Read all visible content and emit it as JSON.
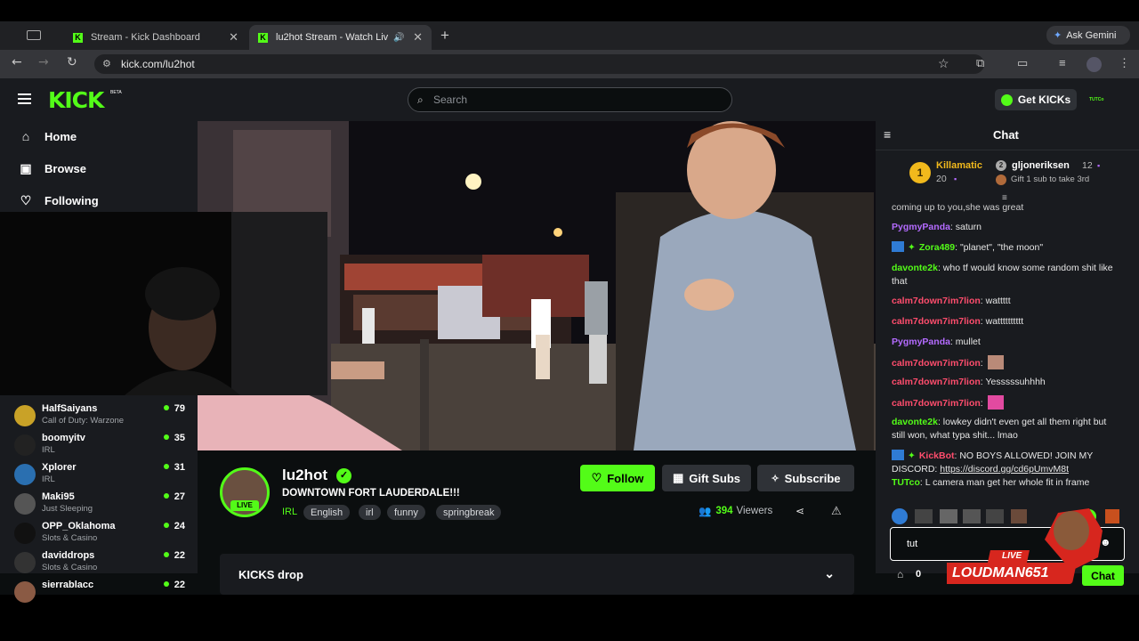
{
  "browser": {
    "tabs": [
      {
        "title": "Stream - Kick Dashboard"
      },
      {
        "title": "lu2hot Stream - Watch Liv"
      }
    ],
    "new_tab": "+",
    "ask_gemini": "Ask Gemini",
    "url": "kick.com/lu2hot"
  },
  "site": {
    "logo": "KICK",
    "beta": "BETA",
    "search_placeholder": "Search",
    "get_kicks": "Get KICKs",
    "user_tag": "TUTCo"
  },
  "sidebar": {
    "nav": [
      {
        "label": "Home",
        "icon": "home-icon"
      },
      {
        "label": "Browse",
        "icon": "browse-icon"
      },
      {
        "label": "Following",
        "icon": "heart-icon"
      }
    ],
    "channels": [
      {
        "name": "HalfSaiyans",
        "category": "Call of Duty: Warzone",
        "viewers": "79",
        "color": "#c9a227"
      },
      {
        "name": "boomyitv",
        "category": "IRL",
        "viewers": "35",
        "color": "#222222"
      },
      {
        "name": "Xplorer",
        "category": "IRL",
        "viewers": "31",
        "color": "#2a6fb0"
      },
      {
        "name": "Maki95",
        "category": "Just Sleeping",
        "viewers": "27",
        "color": "#555555"
      },
      {
        "name": "OPP_Oklahoma",
        "category": "Slots & Casino",
        "viewers": "24",
        "color": "#111111"
      },
      {
        "name": "daviddrops",
        "category": "Slots & Casino",
        "viewers": "22",
        "color": "#333333"
      },
      {
        "name": "sierrablacc",
        "category": "",
        "viewers": "22",
        "color": "#8a5a44"
      }
    ]
  },
  "stream": {
    "streamer": "lu2hot",
    "live": "LIVE",
    "title": "DOWNTOWN FORT LAUDERDALE!!!",
    "category": "IRL",
    "tags": [
      "English",
      "irl",
      "funny",
      "springbreak"
    ],
    "follow": "Follow",
    "gift_subs": "Gift Subs",
    "subscribe": "Subscribe",
    "viewer_count": "394",
    "viewers_label": "Viewers",
    "kicks_drop": "KICKS drop"
  },
  "chat": {
    "title": "Chat",
    "leaderboard": {
      "first": {
        "rank": "1",
        "name": "Killamatic",
        "count": "20"
      },
      "second": {
        "rank": "2",
        "name": "gljoneriksen",
        "count": "12"
      },
      "third_text": "Gift 1 sub to take 3rd"
    },
    "messages": [
      {
        "user": "",
        "color": "#e6e6e6",
        "text": "coming up to you,she was great"
      },
      {
        "user": "PygmyPanda",
        "color": "#b46bff",
        "text": "saturn"
      },
      {
        "user": "Zora489",
        "color": "#53fc18",
        "text": "\"planet\", \"the moon\""
      },
      {
        "user": "davonte2k",
        "color": "#53fc18",
        "text": "who tf would know some random shit like that"
      },
      {
        "user": "calm7down7im7lion",
        "color": "#ff4d6d",
        "text": "wattttt"
      },
      {
        "user": "calm7down7im7lion",
        "color": "#ff4d6d",
        "text": "watttttttttt"
      },
      {
        "user": "PygmyPanda",
        "color": "#b46bff",
        "text": "mullet"
      },
      {
        "user": "calm7down7im7lion",
        "color": "#ff4d6d",
        "text": ""
      },
      {
        "user": "calm7down7im7lion",
        "color": "#ff4d6d",
        "text": "Yesssssuhhhh"
      },
      {
        "user": "calm7down7im7lion",
        "color": "#ff4d6d",
        "text": ""
      },
      {
        "user": "davonte2k",
        "color": "#53fc18",
        "text": "lowkey didn't even get all them right but still won, what typa shit... lmao"
      },
      {
        "user": "KickBot",
        "color": "#ff4d6d",
        "text": "NO BOYS ALLOWED! JOIN MY DISCORD: ",
        "link": "https://discord.gg/cd6pUmvM8t"
      },
      {
        "user": "TUTco",
        "color": "#53fc18",
        "text": "L camera man get her whole fit in frame"
      }
    ],
    "input_value": "tut",
    "kicks_balance": "0",
    "chat_button": "Chat",
    "overlay_live": "LIVE",
    "overlay_name": "LOUDMAN651"
  },
  "colors": {
    "accent": "#53fc18",
    "panel": "#191b1f",
    "page": "#0b0e0f"
  }
}
